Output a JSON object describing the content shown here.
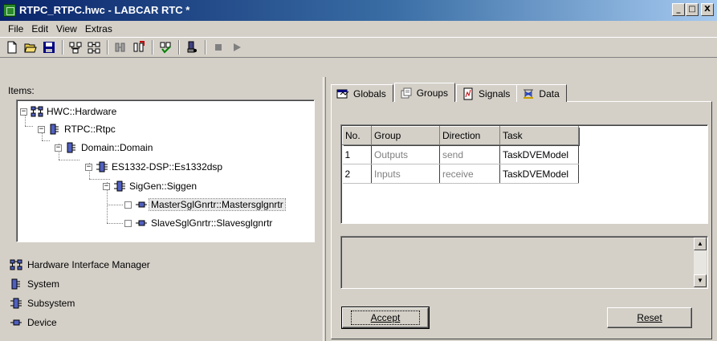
{
  "window": {
    "title": "RTPC_RTPC.hwc - LABCAR RTC  *",
    "buttons": [
      "_",
      "□",
      "X"
    ]
  },
  "menu": [
    "File",
    "Edit",
    "View",
    "Extras"
  ],
  "toolbar": {
    "buttons": [
      "new-file-icon",
      "open-folder-icon",
      "save-icon",
      "hierarchy-icon",
      "hierarchy-alt-icon",
      "config-icon",
      "export-icon",
      "check-icon",
      "connect-icon",
      "stop-icon",
      "play-icon"
    ]
  },
  "left_panel": {
    "items_label": "Items:",
    "tree": [
      {
        "label": "HWC::Hardware",
        "toggle": "−"
      },
      {
        "label": "RTPC::Rtpc",
        "toggle": "−"
      },
      {
        "label": "Domain::Domain",
        "toggle": "−"
      },
      {
        "label": "ES1332-DSP::Es1332dsp",
        "toggle": "−"
      },
      {
        "label": "SigGen::Siggen",
        "toggle": "−"
      },
      {
        "label": "MasterSglGnrtr::Mastersglgnrtr",
        "toggle": ""
      },
      {
        "label": "SlaveSglGnrtr::Slavesglgnrtr",
        "toggle": ""
      }
    ],
    "legend": [
      {
        "label": "Hardware Interface Manager",
        "icon": "hardware-icon"
      },
      {
        "label": "System",
        "icon": "system-icon"
      },
      {
        "label": "Subsystem",
        "icon": "subsystem-icon"
      },
      {
        "label": "Device",
        "icon": "device-icon"
      }
    ]
  },
  "tabs": [
    {
      "label": "Globals",
      "active": false
    },
    {
      "label": "Groups",
      "active": true
    },
    {
      "label": "Signals",
      "active": false
    },
    {
      "label": "Data",
      "active": false
    }
  ],
  "grid": {
    "columns": [
      "No.",
      "Group",
      "Direction",
      "Task"
    ],
    "rows": [
      {
        "no": "1",
        "group": "Outputs",
        "direction": "send",
        "task": "TaskDVEModel"
      },
      {
        "no": "2",
        "group": "Inputs",
        "direction": "receive",
        "task": "TaskDVEModel"
      }
    ]
  },
  "buttons": {
    "accept": "Accept",
    "reset": "Reset"
  },
  "colors": {
    "titlebar_start": "#0a246a",
    "titlebar_end": "#a6caf0",
    "face": "#d4d0c8"
  }
}
